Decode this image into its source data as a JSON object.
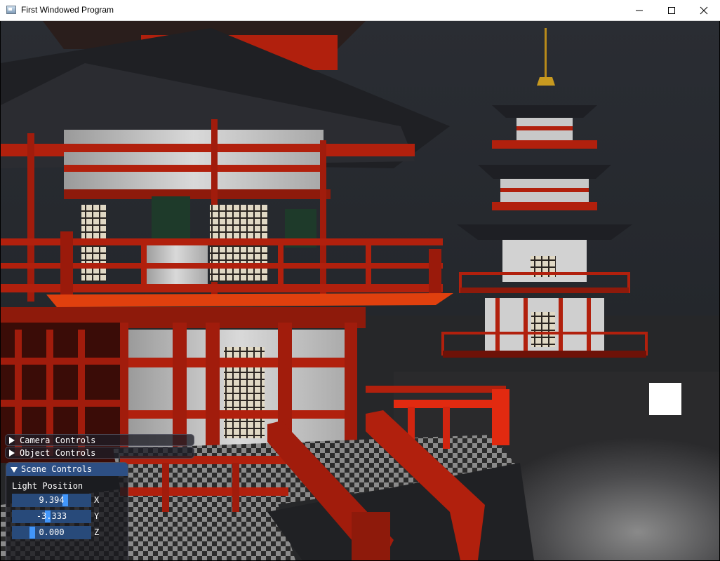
{
  "window": {
    "title": "First Windowed Program",
    "controls": {
      "minimize": "minimize",
      "maximize": "maximize",
      "close": "close"
    }
  },
  "panels": {
    "camera_controls": {
      "label": "Camera Controls",
      "expanded": false
    },
    "object_controls": {
      "label": "Object Controls",
      "expanded": false
    },
    "scene_controls": {
      "label": "Scene Controls",
      "expanded": true,
      "section_label": "Light Position",
      "fields": [
        {
          "value": "9.394",
          "axis": "X"
        },
        {
          "value": "-3.333",
          "axis": "Y"
        },
        {
          "value": "0.000",
          "axis": "Z"
        }
      ]
    }
  },
  "colors": {
    "imgui_header": "#2d4f84",
    "imgui_frame": "#284a7a",
    "imgui_grab": "#4296fa",
    "pagoda_red": "#b1200d",
    "roof_dark": "#1e1f24",
    "light_cube": "#ffffff"
  },
  "icons": {
    "app": "app-window-icon",
    "minimize": "minimize-icon",
    "maximize": "maximize-icon",
    "close": "close-icon"
  }
}
